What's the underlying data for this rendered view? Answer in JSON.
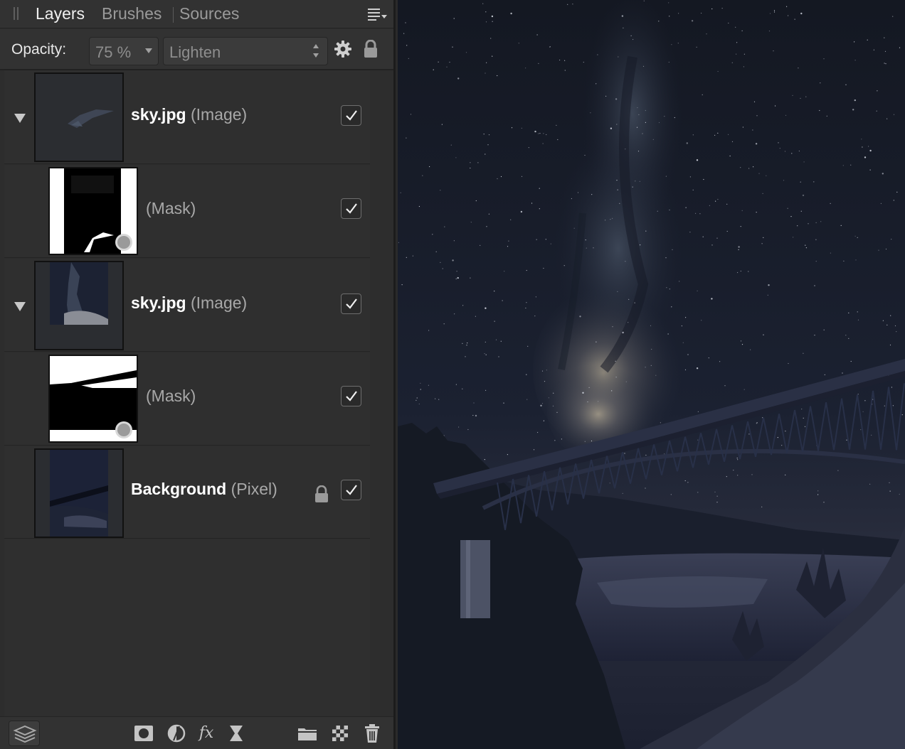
{
  "panel": {
    "tabs": [
      {
        "label": "Layers",
        "active": true
      },
      {
        "label": "Brushes",
        "active": false
      },
      {
        "label": "Sources",
        "active": false
      }
    ],
    "opacity_label": "Opacity:",
    "opacity_value": "75 %",
    "blend_mode": "Lighten"
  },
  "layers": [
    {
      "name": "sky.jpg",
      "type": "(Image)",
      "expanded": true,
      "visible": true
    },
    {
      "name": "",
      "type": "(Mask)",
      "visible": true
    },
    {
      "name": "sky.jpg",
      "type": "(Image)",
      "expanded": true,
      "visible": true
    },
    {
      "name": "",
      "type": "(Mask)",
      "visible": true
    },
    {
      "name": "Background",
      "type": "(Pixel)",
      "locked": true,
      "visible": true
    }
  ],
  "toolbar_icons": [
    "layers-stack-icon",
    "mask-icon",
    "adjustment-icon",
    "fx-icon",
    "live-filter-icon",
    "group-folder-icon",
    "pixel-layer-icon",
    "trash-icon"
  ],
  "fx_label": "fx",
  "colors": {
    "panel_bg": "#2d2d2d",
    "tab_active": "#f0f0f0",
    "tab_inactive": "#9a9a9a",
    "canvas_sky": "#121624"
  }
}
